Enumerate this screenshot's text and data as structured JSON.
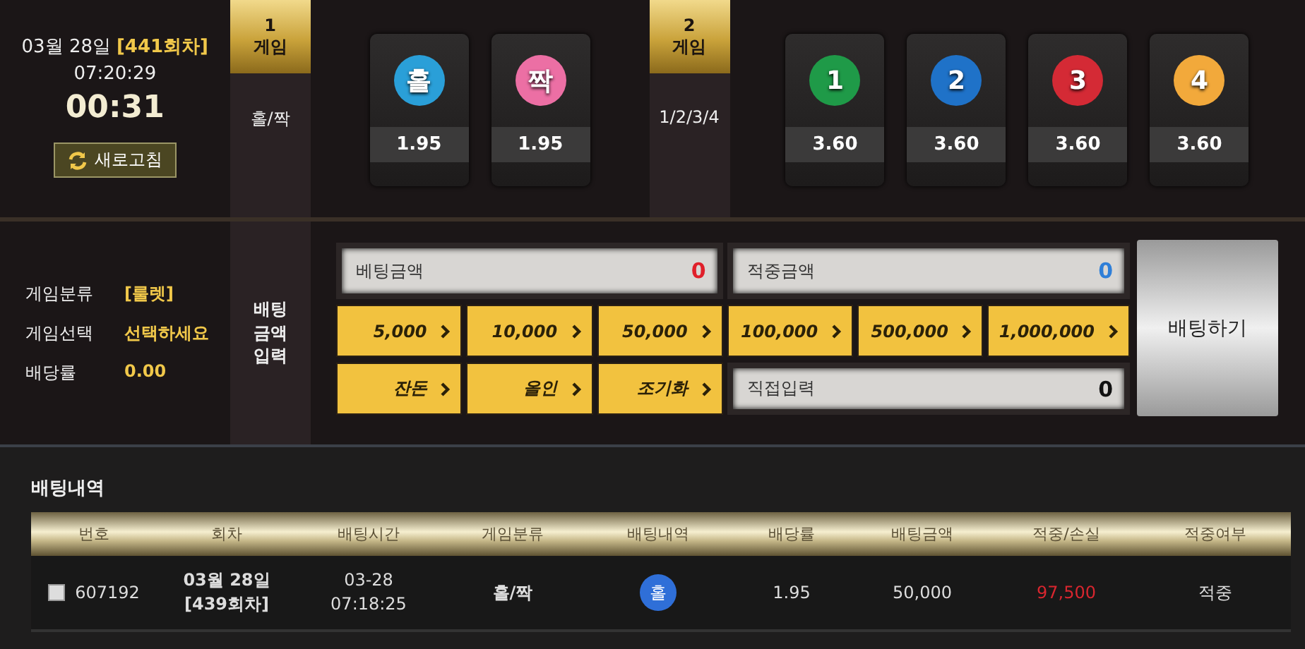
{
  "header": {
    "date": "03월 28일",
    "round": "[441회차]",
    "time": "07:20:29",
    "countdown": "00:31",
    "refresh_button": "새로고침"
  },
  "games": [
    {
      "number": "1",
      "label": "게임",
      "type_name": "홀/짝",
      "options": [
        {
          "label": "홀",
          "odds": "1.95",
          "color": "#2a9fd8"
        },
        {
          "label": "짝",
          "odds": "1.95",
          "color": "#ec6fa4"
        }
      ]
    },
    {
      "number": "2",
      "label": "게임",
      "type_name": "1/2/3/4",
      "options": [
        {
          "label": "1",
          "odds": "3.60",
          "color": "#1f9a48"
        },
        {
          "label": "2",
          "odds": "3.60",
          "color": "#1f72c8"
        },
        {
          "label": "3",
          "odds": "3.60",
          "color": "#d42a35"
        },
        {
          "label": "4",
          "odds": "3.60",
          "color": "#f2a93b"
        }
      ]
    }
  ],
  "selection": [
    {
      "label": "게임분류",
      "value": "[룰렛]"
    },
    {
      "label": "게임선택",
      "value": "선택하세요"
    },
    {
      "label": "배당률",
      "value": "0.00"
    }
  ],
  "bet_panel": {
    "title_lines": [
      "배팅",
      "금액",
      "입력"
    ],
    "bet_amount": {
      "label": "베팅금액",
      "value": "0"
    },
    "win_amount": {
      "label": "적중금액",
      "value": "0"
    },
    "amount_buttons": [
      "5,000",
      "10,000",
      "50,000",
      "100,000",
      "500,000",
      "1,000,000"
    ],
    "action_buttons": [
      "잔돈",
      "올인",
      "조기화"
    ],
    "direct_input": {
      "label": "직접입력",
      "value": "0"
    },
    "bet_button": "배팅하기"
  },
  "history": {
    "title": "배팅내역",
    "columns": [
      "번호",
      "회차",
      "배팅시간",
      "게임분류",
      "배팅내역",
      "배당률",
      "배팅금액",
      "적중/손실",
      "적중여부"
    ],
    "rows": [
      {
        "checked": false,
        "number": "607192",
        "round": [
          "03월 28일",
          "[439회차]"
        ],
        "time": [
          "03-28",
          "07:18:25"
        ],
        "game_type": "홀/짝",
        "pick": {
          "label": "홀",
          "color": "#2f6fd8"
        },
        "odds": "1.95",
        "amount": "50,000",
        "profit": "97,500",
        "result": "적중"
      }
    ]
  }
}
